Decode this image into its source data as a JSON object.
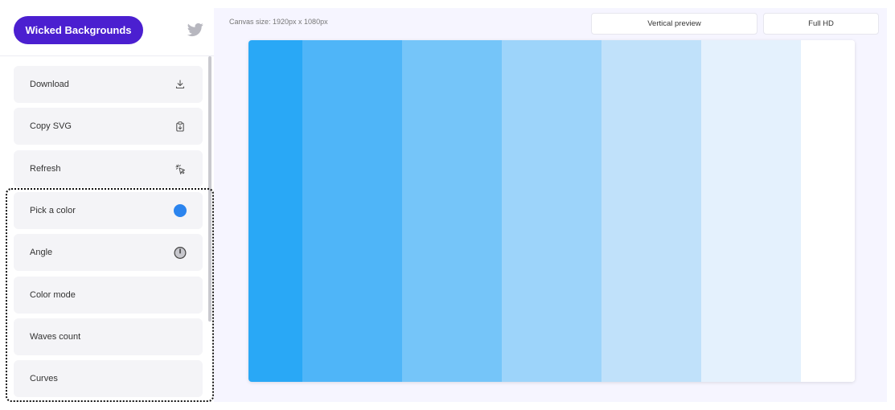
{
  "sidebar": {
    "brand_label": "Wicked Backgrounds",
    "items": [
      {
        "label": "Download",
        "icon": "download-icon"
      },
      {
        "label": "Copy SVG",
        "icon": "clipboard-icon"
      },
      {
        "label": "Refresh",
        "icon": "pointer-click-icon"
      },
      {
        "label": "Pick a color",
        "icon": "color-dot-icon",
        "color": "#2b84ee"
      },
      {
        "label": "Angle",
        "icon": "clock-icon"
      },
      {
        "label": "Color mode",
        "icon": ""
      },
      {
        "label": "Waves count",
        "icon": ""
      },
      {
        "label": "Curves",
        "icon": ""
      }
    ]
  },
  "main": {
    "canvas_size_text": "Canvas size: 1920px x 1080px",
    "vertical_preview_label": "Vertical preview",
    "resolution_label": "Full HD"
  },
  "preview": {
    "stripe_colors": [
      "#29a8f6",
      "#4fb5f8",
      "#75c5f9",
      "#9dd4fa",
      "#c0e1fa",
      "#e4f1fd",
      "#ffffff"
    ]
  },
  "colors": {
    "brand": "#4b1fd0",
    "panel_bg": "#f6f5ff",
    "item_bg": "#f4f4f7"
  }
}
